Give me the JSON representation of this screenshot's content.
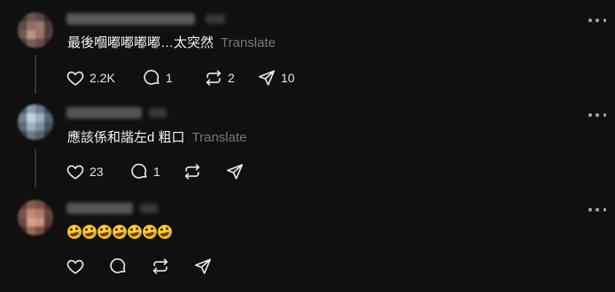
{
  "replies": [
    {
      "text": "最後嗰嘟嘟嘟嘟…太突然",
      "translate_label": "Translate",
      "actions": {
        "likes": "2.2K",
        "comments": "1",
        "reposts": "2",
        "shares": "10"
      }
    },
    {
      "text": "應該係和諧左d 粗口",
      "translate_label": "Translate",
      "actions": {
        "likes": "23",
        "comments": "1",
        "reposts": "",
        "shares": ""
      }
    },
    {
      "emoji_text": "🤣🤣🤣🤣🤣🤣🤣",
      "emoji_name": "rolling-on-the-floor-laughing",
      "emoji_count": 7,
      "actions": {
        "likes": "",
        "comments": "",
        "reposts": "",
        "shares": ""
      }
    }
  ],
  "icons": {
    "like": "heart-icon",
    "comment": "comment-bubble-icon",
    "repost": "repost-arrows-icon",
    "share": "send-paper-plane-icon",
    "more": "more-dots-icon"
  },
  "colors": {
    "background": "#101010",
    "text": "#f3f5f7",
    "muted": "#777777",
    "thread_line": "#333638"
  }
}
